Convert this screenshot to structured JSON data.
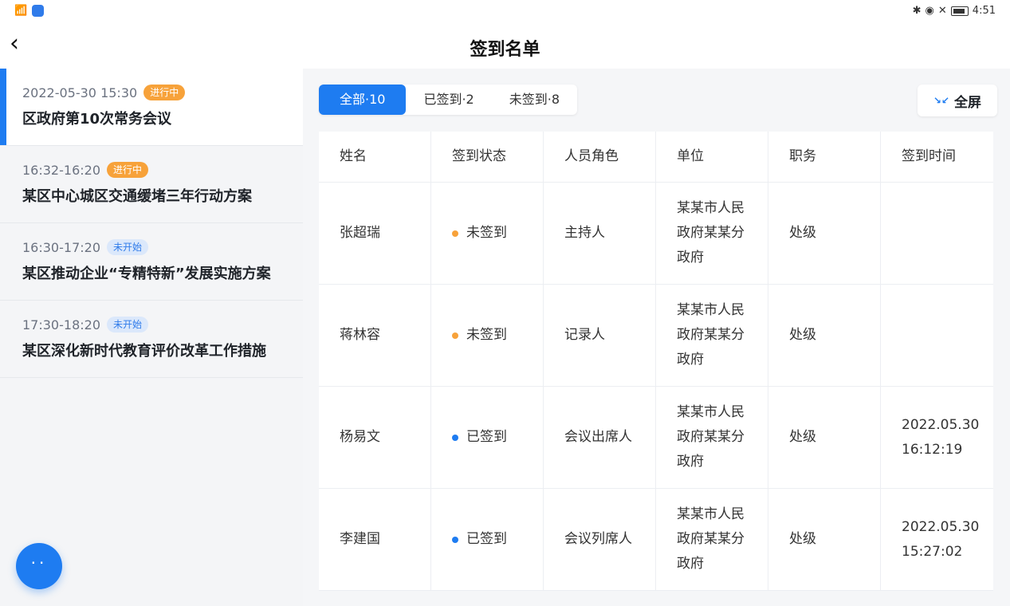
{
  "status_bar": {
    "time": "4:51",
    "icons": [
      "wifi-icon",
      "app-icon",
      "bluetooth-icon",
      "location-icon",
      "mute-icon",
      "battery-icon"
    ]
  },
  "header": {
    "title": "签到名单"
  },
  "meetings": [
    {
      "time": "2022-05-30 15:30",
      "status": "进行中",
      "title": "区政府第10次常务会议"
    },
    {
      "time": "16:32-16:20",
      "status": "进行中",
      "title": "某区中心城区交通缓堵三年行动方案"
    },
    {
      "time": "16:30-17:20",
      "status": "未开始",
      "title": "某区推动企业“专精特新”发展实施方案"
    },
    {
      "time": "17:30-18:20",
      "status": "未开始",
      "title": "某区深化新时代教育评价改革工作措施"
    }
  ],
  "tabs": [
    {
      "label": "全部·10"
    },
    {
      "label": "已签到·2"
    },
    {
      "label": "未签到·8"
    }
  ],
  "fullscreen_label": "全屏",
  "table": {
    "headers": [
      "姓名",
      "签到状态",
      "人员角色",
      "单位",
      "职务",
      "签到时间"
    ],
    "rows": [
      {
        "name": "张超瑞",
        "status": "未签到",
        "role": "主持人",
        "unit": "某某市人民政府某某分政府",
        "position": "处级",
        "time_date": "",
        "time_clock": ""
      },
      {
        "name": "蒋林容",
        "status": "未签到",
        "role": "记录人",
        "unit": "某某市人民政府某某分政府",
        "position": "处级",
        "time_date": "",
        "time_clock": ""
      },
      {
        "name": "杨易文",
        "status": "已签到",
        "role": "会议出席人",
        "unit": "某某市人民政府某某分政府",
        "position": "处级",
        "time_date": "2022.05.30",
        "time_clock": "16:12:19"
      },
      {
        "name": "李建国",
        "status": "已签到",
        "role": "会议列席人",
        "unit": "某某市人民政府某某分政府",
        "position": "处级",
        "time_date": "2022.05.30",
        "time_clock": "15:27:02"
      }
    ]
  },
  "colors": {
    "primary": "#1e7cf1",
    "ongoing": "#f7a23a",
    "pending_bg": "#dbe8fb"
  }
}
